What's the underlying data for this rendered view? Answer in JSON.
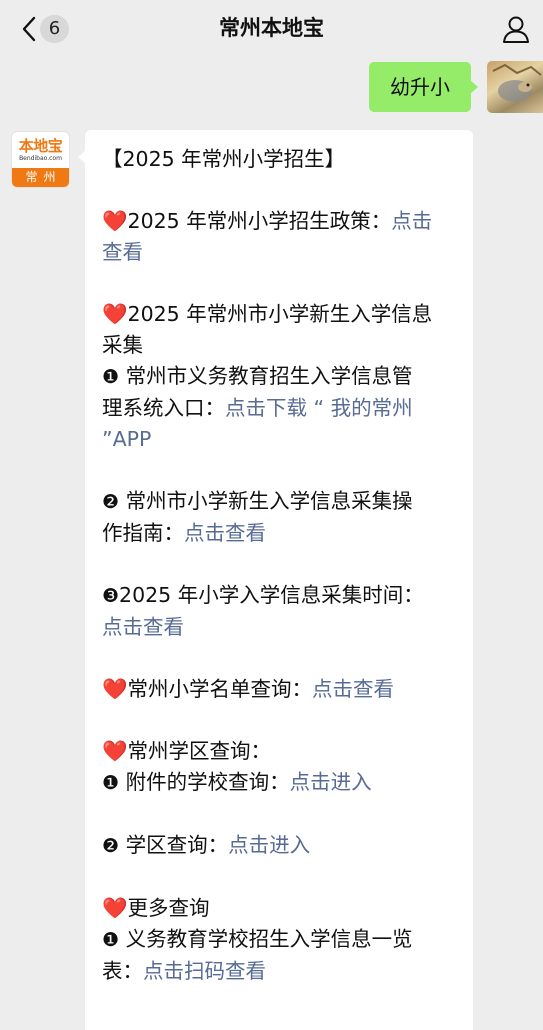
{
  "header": {
    "title": "常州本地宝",
    "unread_count": "6",
    "back_icon": "chevron-left-icon",
    "profile_icon": "person-icon"
  },
  "outgoing": {
    "text": "幼升小"
  },
  "account": {
    "logo_text": "本地宝",
    "domain": "Bendibao.com",
    "city": "常州",
    "brand_color": "#ef7a14"
  },
  "message": {
    "heading": "【2025 年常州小学招生】",
    "policy_label": "2025 年常州小学招生政策：",
    "policy_link_1": "点击",
    "policy_link_2": "查看",
    "collect_title_1": "2025 年常州市小学新生入学信息",
    "collect_title_2": "采集",
    "item1_num": "❶",
    "item1_line1": " 常州市义务教育招生入学信息管",
    "item1_line2_label": "理系统入口：",
    "item1_line2_link": "点击下载 “ 我的常州",
    "item1_line3_link": "”APP",
    "item2_num": "❷",
    "item2_line1": " 常州市小学新生入学信息采集操",
    "item2_line2_label": "作指南：",
    "item2_line2_link": "点击查看",
    "item3_num": "❸",
    "item3_line1": "2025 年小学入学信息采集时间：",
    "item3_line2_link": "点击查看",
    "list_label": "常州小学名单查询：",
    "list_link": "点击查看",
    "district_title": "常州学区查询：",
    "d1_num": "❶",
    "d1_label": " 附件的学校查询：",
    "d1_link": "点击进入",
    "d2_num": "❷",
    "d2_label": " 学区查询：",
    "d2_link": "点击进入",
    "more_title": "更多查询",
    "m1_num": "❶",
    "m1_line1": " 义务教育学校招生入学信息一览",
    "m1_line2_label": "表：",
    "m1_line2_link": "点击扫码查看",
    "heart_glyph": "❤️",
    "link_color": "#576b95"
  }
}
